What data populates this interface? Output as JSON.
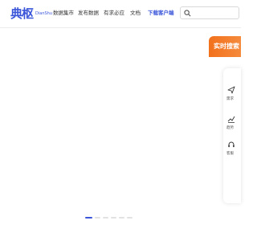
{
  "header": {
    "logo_text": "典枢",
    "logo_sub": "DianShu",
    "nav": [
      {
        "label": "数据集市"
      },
      {
        "label": "发布数据"
      },
      {
        "label": "有求必应"
      },
      {
        "label": "文档"
      },
      {
        "label": "下载客户端"
      }
    ],
    "search_placeholder": ""
  },
  "side_widget": {
    "banner_text": "实时搜索",
    "items": [
      {
        "label": "需求",
        "icon": "send-icon"
      },
      {
        "label": "趋势",
        "icon": "trend-chart-icon"
      },
      {
        "label": "客服",
        "icon": "headset-icon"
      }
    ]
  },
  "carousel": {
    "slide_count": 6,
    "active_index": 0
  },
  "colors": {
    "brand": "#3b56d9",
    "accent_orange": "#f2711c"
  }
}
